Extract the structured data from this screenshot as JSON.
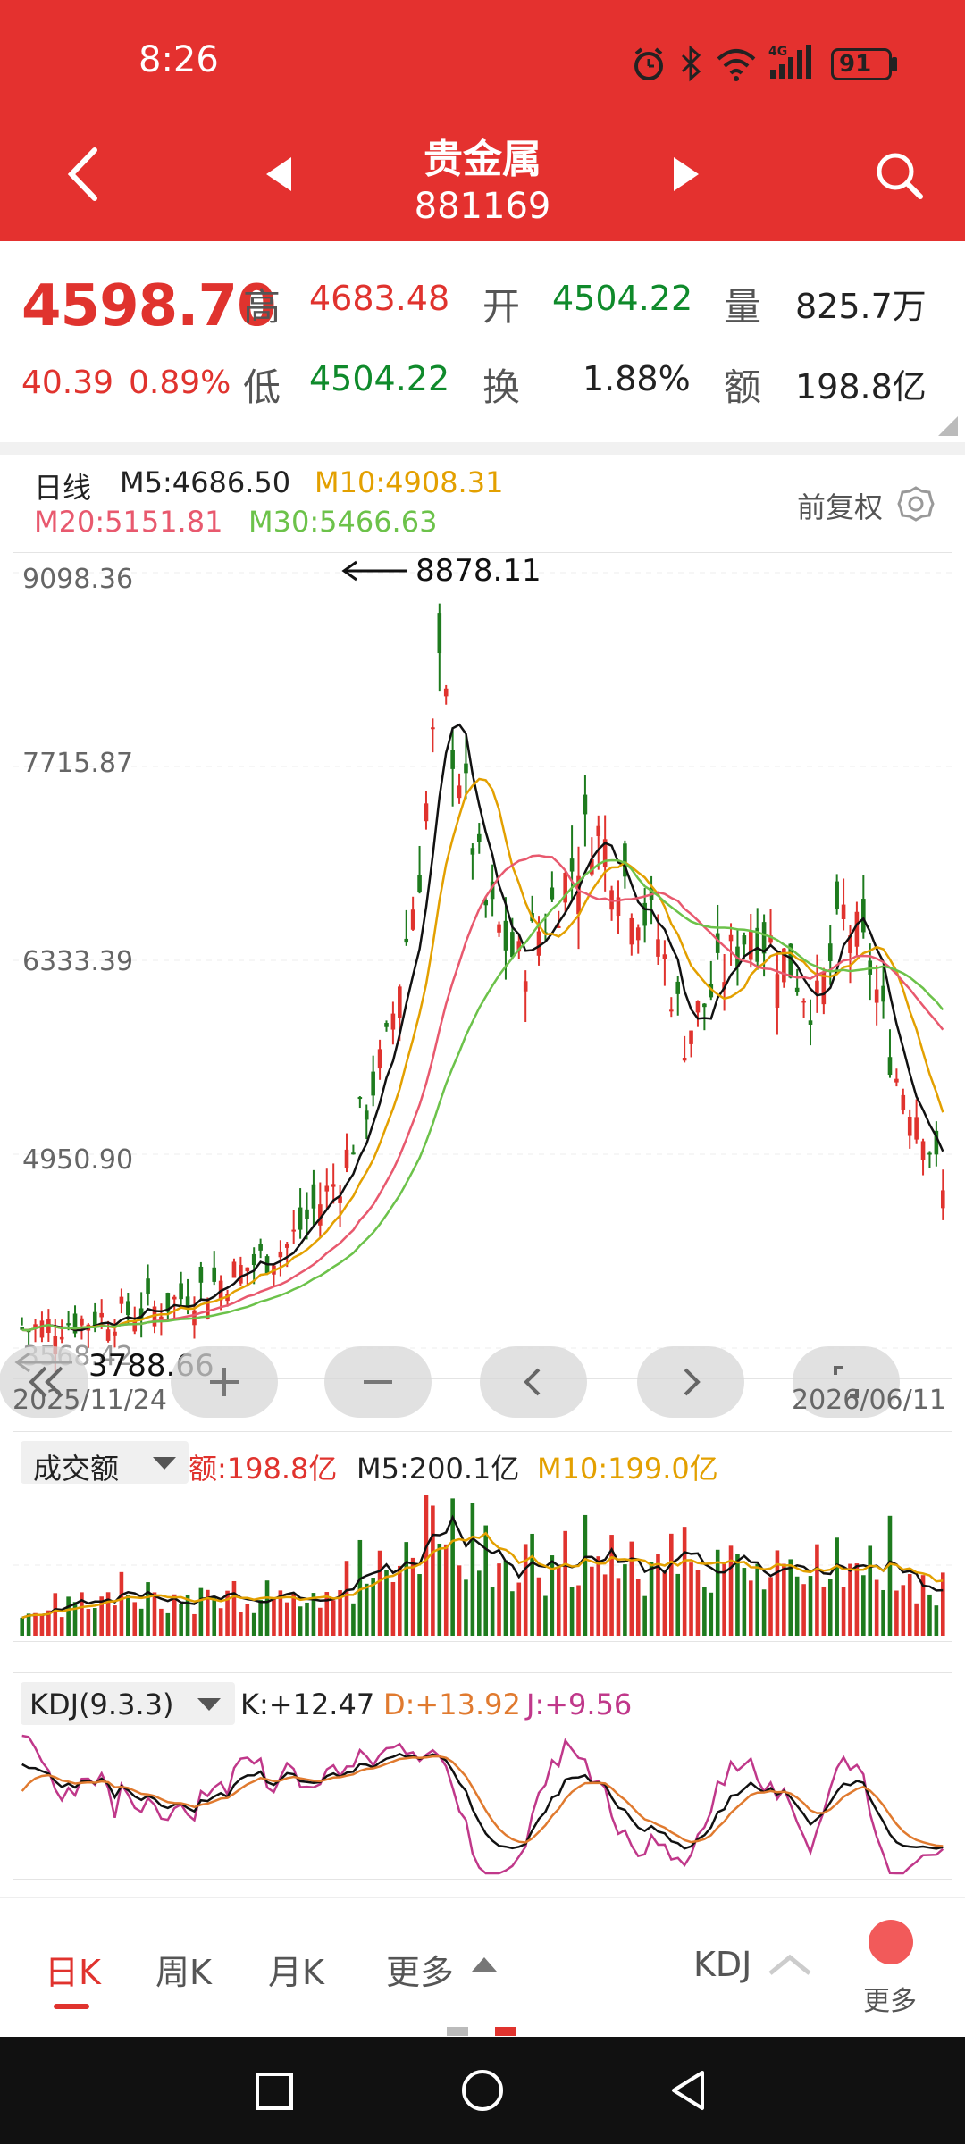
{
  "status": {
    "time": "8:26",
    "battery": "91",
    "network": "4G"
  },
  "nav": {
    "title": "贵金属",
    "code": "881169"
  },
  "quote": {
    "price": "4598.70",
    "change": "40.39",
    "change_pct": "0.89%",
    "high_label": "高",
    "high": "4683.48",
    "low_label": "低",
    "low": "4504.22",
    "open_label": "开",
    "open": "4504.22",
    "turnover_label": "换",
    "turnover": "1.88%",
    "volume_label": "量",
    "volume": "825.7万",
    "amount_label": "额",
    "amount": "198.8亿"
  },
  "kline": {
    "period": "日线",
    "ma5": "M5:4686.50",
    "ma10": "M10:4908.31",
    "ma20": "M20:5151.81",
    "ma30": "M30:5466.63",
    "adjust": "前复权",
    "y_ticks": [
      "9098.36",
      "7715.87",
      "6333.39",
      "4950.90",
      "3568.42"
    ],
    "max_marker": "8878.11",
    "min_marker": "3788.66",
    "date_start": "2025/11/24",
    "date_end": "2026/06/11",
    "colors": {
      "up": "#e0332e",
      "down": "#1e7b1e",
      "ma5": "#111111",
      "ma10": "#e3a000",
      "ma20": "#e8596e",
      "ma30": "#6cc24a"
    }
  },
  "volume_panel": {
    "indicator": "成交额",
    "amount": "额:198.8亿",
    "m5": "M5:200.1亿",
    "m10": "M10:199.0亿"
  },
  "kdj_panel": {
    "indicator": "KDJ(9.3.3)",
    "k": "K:+12.47",
    "d": "D:+13.92",
    "j": "J:+9.56"
  },
  "tabs": {
    "day": "日K",
    "week": "周K",
    "month": "月K",
    "more": "更多",
    "indicator": "KDJ",
    "more_right": "更多"
  },
  "icons": {
    "back": "chevron-left-icon",
    "prev": "triangle-left-icon",
    "next": "triangle-right-icon",
    "search": "search-icon",
    "settings": "gear-icon",
    "zoom_in": "plus-icon",
    "zoom_out": "minus-icon",
    "rewind": "double-chevron-left-icon",
    "fullscreen": "fullscreen-icon"
  }
}
